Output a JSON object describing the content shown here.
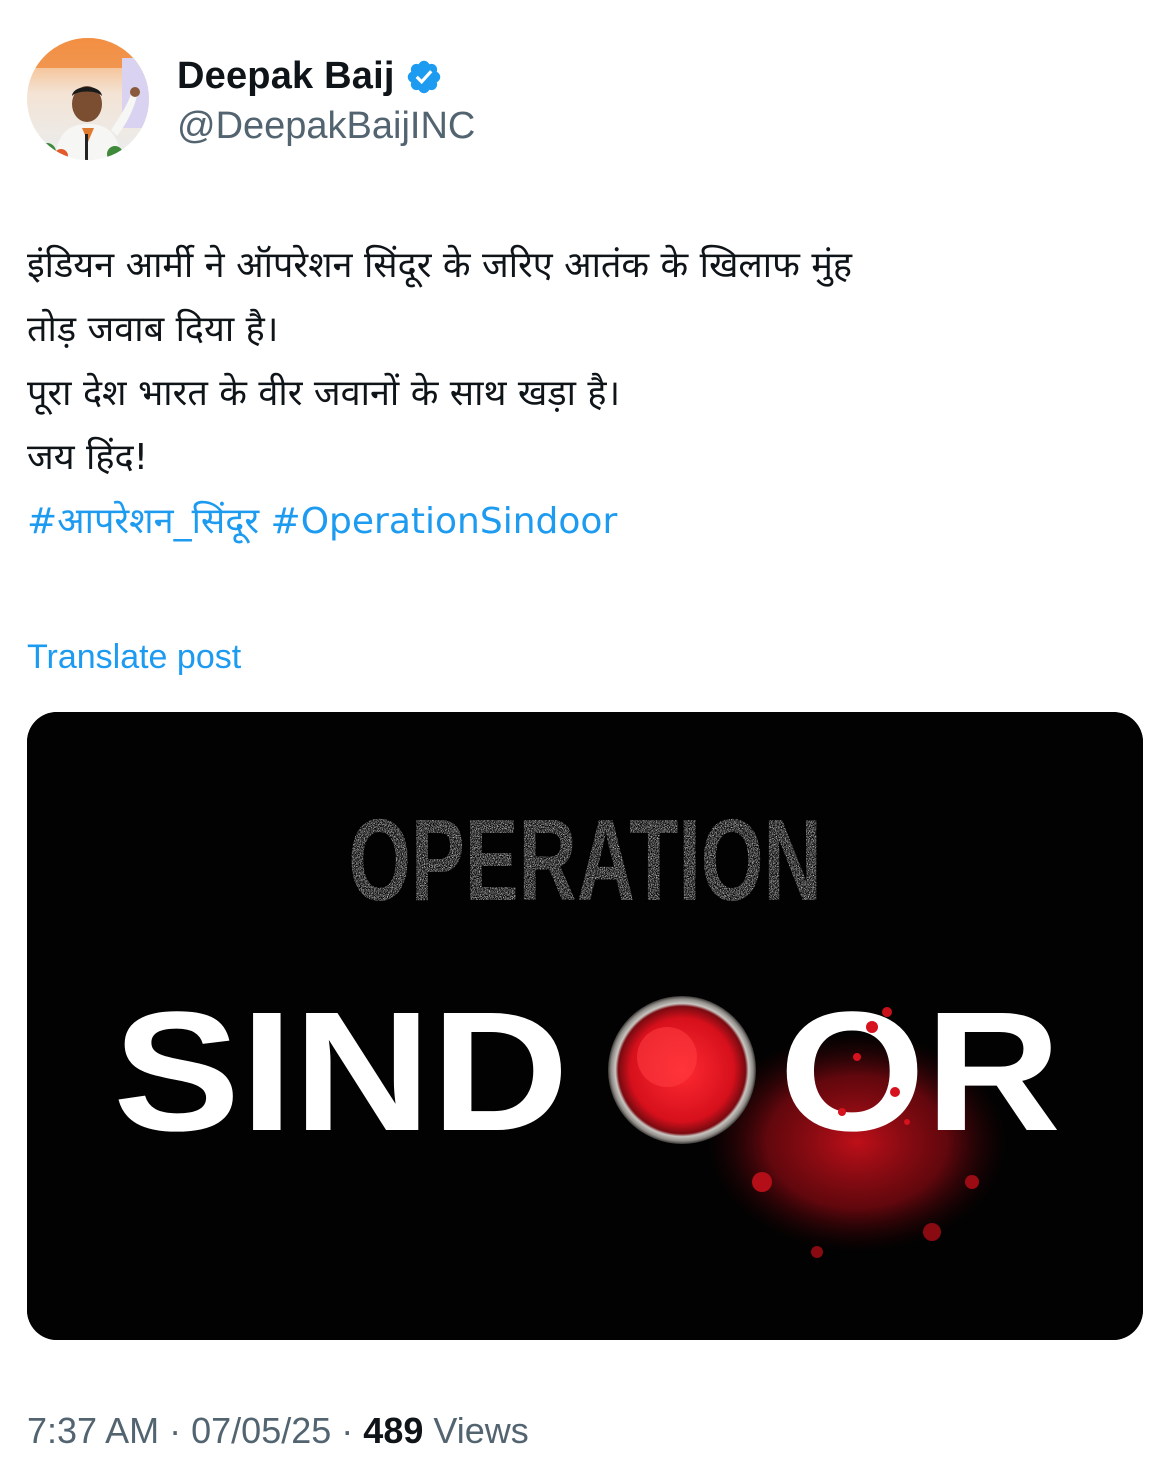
{
  "author": {
    "display_name": "Deepak Baij",
    "handle": "@DeepakBaijINC",
    "verified_icon": "verified-badge-icon",
    "badge_color": "#1d9bf0"
  },
  "tweet": {
    "lines": [
      "इंडियन आर्मी ने ऑपरेशन सिंदूर के जरिए आतंक के खिलाफ मुंह",
      "तोड़ जवाब दिया है।",
      "पूरा देश भारत के वीर जवानों के साथ खड़ा है।",
      "जय हिंद!"
    ],
    "hashtags": [
      "#आपरेशन_सिंदूर",
      "#OperationSindoor"
    ]
  },
  "translate_label": "Translate post",
  "media": {
    "title_top": "OPERATION",
    "title_bottom_left": "SIND",
    "title_bottom_right": "OR",
    "background_color": "#020202",
    "accent_color": "#d5121e"
  },
  "meta": {
    "time": "7:37 AM",
    "date": "07/05/25",
    "separator": "·",
    "views_count": "489",
    "views_label": "Views"
  }
}
